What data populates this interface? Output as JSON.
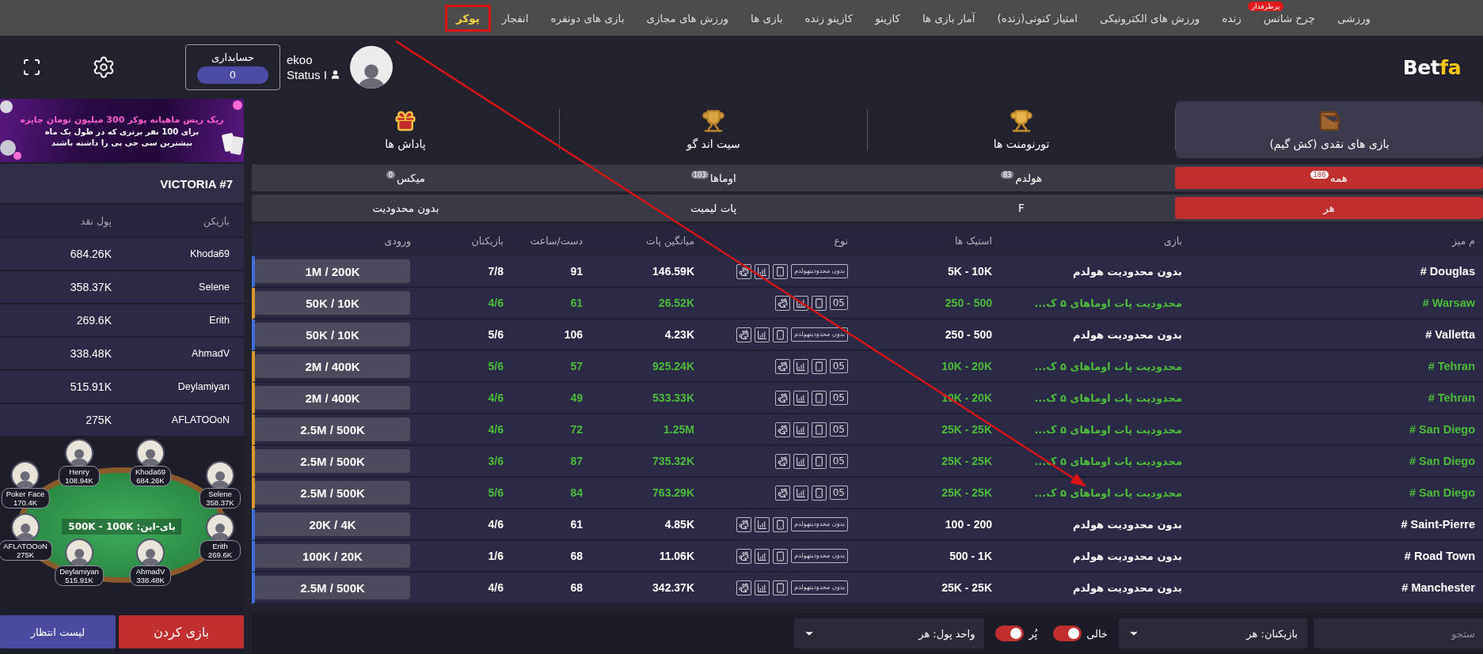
{
  "nav": {
    "items": [
      {
        "label": "ورزشی",
        "selected": false,
        "highlighted": false
      },
      {
        "label": "چرخ شانس",
        "badge": "پرطرفدار",
        "selected": false,
        "highlighted": false
      },
      {
        "label": "زنده",
        "selected": false,
        "highlighted": false
      },
      {
        "label": "ورزش های الکترونیکی",
        "selected": false,
        "highlighted": false
      },
      {
        "label": "امتیاز کنونی(زنده)",
        "selected": false,
        "highlighted": false
      },
      {
        "label": "آمار بازی ها",
        "selected": false,
        "highlighted": false
      },
      {
        "label": "کازینو",
        "selected": false,
        "highlighted": false
      },
      {
        "label": "کازینو زنده",
        "selected": false,
        "highlighted": false
      },
      {
        "label": "بازی ها",
        "selected": false,
        "highlighted": false
      },
      {
        "label": "ورزش های مجازی",
        "selected": false,
        "highlighted": false
      },
      {
        "label": "بازی های دونفره",
        "selected": false,
        "highlighted": false
      },
      {
        "label": "انفجار",
        "selected": false,
        "highlighted": false
      },
      {
        "label": "پوکر",
        "selected": true,
        "highlighted": true
      }
    ]
  },
  "pointer_arrow": true,
  "header": {
    "logo": {
      "main": "Bet",
      "accent": "fa"
    },
    "user": {
      "name": "ekoo",
      "status": "Status I"
    },
    "account": {
      "label": "حسابداری",
      "balance": "0"
    }
  },
  "categories": [
    {
      "kind": "cash",
      "label": "بازی های نقدی (کش گیم)",
      "selected": true
    },
    {
      "kind": "tournament",
      "label": "تورنومنت ها",
      "selected": false
    },
    {
      "kind": "sitngo",
      "label": "سیت اند گو",
      "selected": false
    },
    {
      "kind": "rewards",
      "label": "پاداش ها",
      "selected": false
    }
  ],
  "game_filters": [
    {
      "label": "همه",
      "count": "186",
      "selected": true
    },
    {
      "label": "هولدم",
      "count": "83",
      "selected": false
    },
    {
      "label": "اوماها",
      "count": "103",
      "selected": false
    },
    {
      "label": "میکس",
      "count": "0",
      "selected": false
    }
  ],
  "limit_filters": [
    {
      "label": "هر",
      "selected": true
    },
    {
      "label": "F",
      "selected": false
    },
    {
      "label": "پات لیمیت",
      "selected": false
    },
    {
      "label": "بدون محدودیت",
      "selected": false
    }
  ],
  "table": {
    "columns": [
      "م میز",
      "بازی",
      "استیک ها",
      "نوع",
      "میانگین پات",
      "دست/ساعت",
      "بازیکنان",
      "ورودی"
    ],
    "rows": [
      {
        "kind": "holdem",
        "name": "Douglas #",
        "game": "بدون محدودیت هولدم",
        "stakes": "5K - 10K",
        "badge": "بدون محدودیتهولدم",
        "avg_pot": "146.59K",
        "hands_per_hour": "91",
        "players": "7/8",
        "buy_in": "1M / 200K"
      },
      {
        "kind": "omaha",
        "name": "Warsaw #",
        "game": "محدودیت پات اوماهای ۵ ک...",
        "stakes": "250 - 500",
        "badge": "05",
        "avg_pot": "26.52K",
        "hands_per_hour": "61",
        "players": "4/6",
        "buy_in": "50K / 10K"
      },
      {
        "kind": "holdem",
        "name": "Valletta #",
        "game": "بدون محدودیت هولدم",
        "stakes": "250 - 500",
        "badge": "بدون محدودیتهولدم",
        "avg_pot": "4.23K",
        "hands_per_hour": "106",
        "players": "5/6",
        "buy_in": "50K / 10K"
      },
      {
        "kind": "omaha",
        "name": "Tehran #",
        "game": "محدودیت پات اوماهای ۵ ک...",
        "stakes": "10K - 20K",
        "badge": "05",
        "avg_pot": "925.24K",
        "hands_per_hour": "57",
        "players": "5/6",
        "buy_in": "2M / 400K"
      },
      {
        "kind": "omaha",
        "name": "Tehran #",
        "game": "محدودیت پات اوماهای ۵ ک...",
        "stakes": "10K - 20K",
        "badge": "05",
        "avg_pot": "533.33K",
        "hands_per_hour": "49",
        "players": "4/6",
        "buy_in": "2M / 400K"
      },
      {
        "kind": "omaha",
        "name": "San Diego #",
        "game": "محدودیت پات اوماهای ۵ ک...",
        "stakes": "25K - 25K",
        "badge": "05",
        "avg_pot": "1.25M",
        "hands_per_hour": "72",
        "players": "4/6",
        "buy_in": "2.5M / 500K"
      },
      {
        "kind": "omaha",
        "name": "San Diego #",
        "game": "محدودیت پات اوماهای ۵ ک...",
        "stakes": "25K - 25K",
        "badge": "05",
        "avg_pot": "735.32K",
        "hands_per_hour": "87",
        "players": "3/6",
        "buy_in": "2.5M / 500K"
      },
      {
        "kind": "omaha",
        "name": "San Diego #",
        "game": "محدودیت پات اوماهای ۵ ک...",
        "stakes": "25K - 25K",
        "badge": "05",
        "avg_pot": "763.29K",
        "hands_per_hour": "84",
        "players": "5/6",
        "buy_in": "2.5M / 500K"
      },
      {
        "kind": "holdem",
        "name": "Saint-Pierre #",
        "game": "بدون محدودیت هولدم",
        "stakes": "100 - 200",
        "badge": "بدون محدودیتهولدم",
        "avg_pot": "4.85K",
        "hands_per_hour": "61",
        "players": "4/6",
        "buy_in": "20K / 4K"
      },
      {
        "kind": "holdem",
        "name": "Road Town #",
        "game": "بدون محدودیت هولدم",
        "stakes": "500 - 1K",
        "badge": "بدون محدودیتهولدم",
        "avg_pot": "11.06K",
        "hands_per_hour": "68",
        "players": "1/6",
        "buy_in": "100K / 20K"
      },
      {
        "kind": "holdem",
        "name": "Manchester #",
        "game": "بدون محدودیت هولدم",
        "stakes": "25K - 25K",
        "badge": "بدون محدودیتهولدم",
        "avg_pot": "342.37K",
        "hands_per_hour": "68",
        "players": "4/6",
        "buy_in": "2.5M / 500K"
      }
    ]
  },
  "sidebar": {
    "banner": {
      "title": "ریک ریس ماهیانه پوکر 300 میلیون تومان جایزه",
      "lines": [
        "برای 100 نفر برتری  که در طول یک ماه",
        "بیشترین سی جی پی را داشته باشند"
      ]
    },
    "selected_table": {
      "title": "VICTORIA #7",
      "columns": [
        "بازیکن",
        "پول نقد"
      ],
      "players": [
        {
          "name": "Khoda69",
          "cash": "684.26K"
        },
        {
          "name": "Selene",
          "cash": "358.37K"
        },
        {
          "name": "Erith",
          "cash": "269.6K"
        },
        {
          "name": "AhmadV",
          "cash": "338.48K"
        },
        {
          "name": "Deylamiyan",
          "cash": "515.91K"
        },
        {
          "name": "AFLATOOoN",
          "cash": "275K"
        }
      ]
    },
    "seating": {
      "buy_in": "بای-این: 500K - 100K",
      "seats": [
        {
          "name": "Khoda69",
          "cash": "684.26K"
        },
        {
          "name": "Henry",
          "cash": "108.94K"
        },
        {
          "name": "Selene",
          "cash": "358.37K"
        },
        {
          "name": "Poker Face",
          "cash": "170.4K"
        },
        {
          "name": "Erith",
          "cash": "269.6K"
        },
        {
          "name": "AFLATOOoN",
          "cash": "275K"
        },
        {
          "name": "AhmadV",
          "cash": "338.48K"
        },
        {
          "name": "Deylamiyan",
          "cash": "515.91K"
        }
      ]
    },
    "buttons": {
      "play": "بازی کردن",
      "waitlist": "لیست انتظار"
    }
  },
  "bottom_bar": {
    "search": {
      "placeholder": "ستجو"
    },
    "players_filter": "بازیکنان: هر",
    "toggles": [
      {
        "label": "خالی",
        "on": true
      },
      {
        "label": "پُر",
        "on": true
      }
    ],
    "currency_filter": "واحد پول: هر"
  }
}
